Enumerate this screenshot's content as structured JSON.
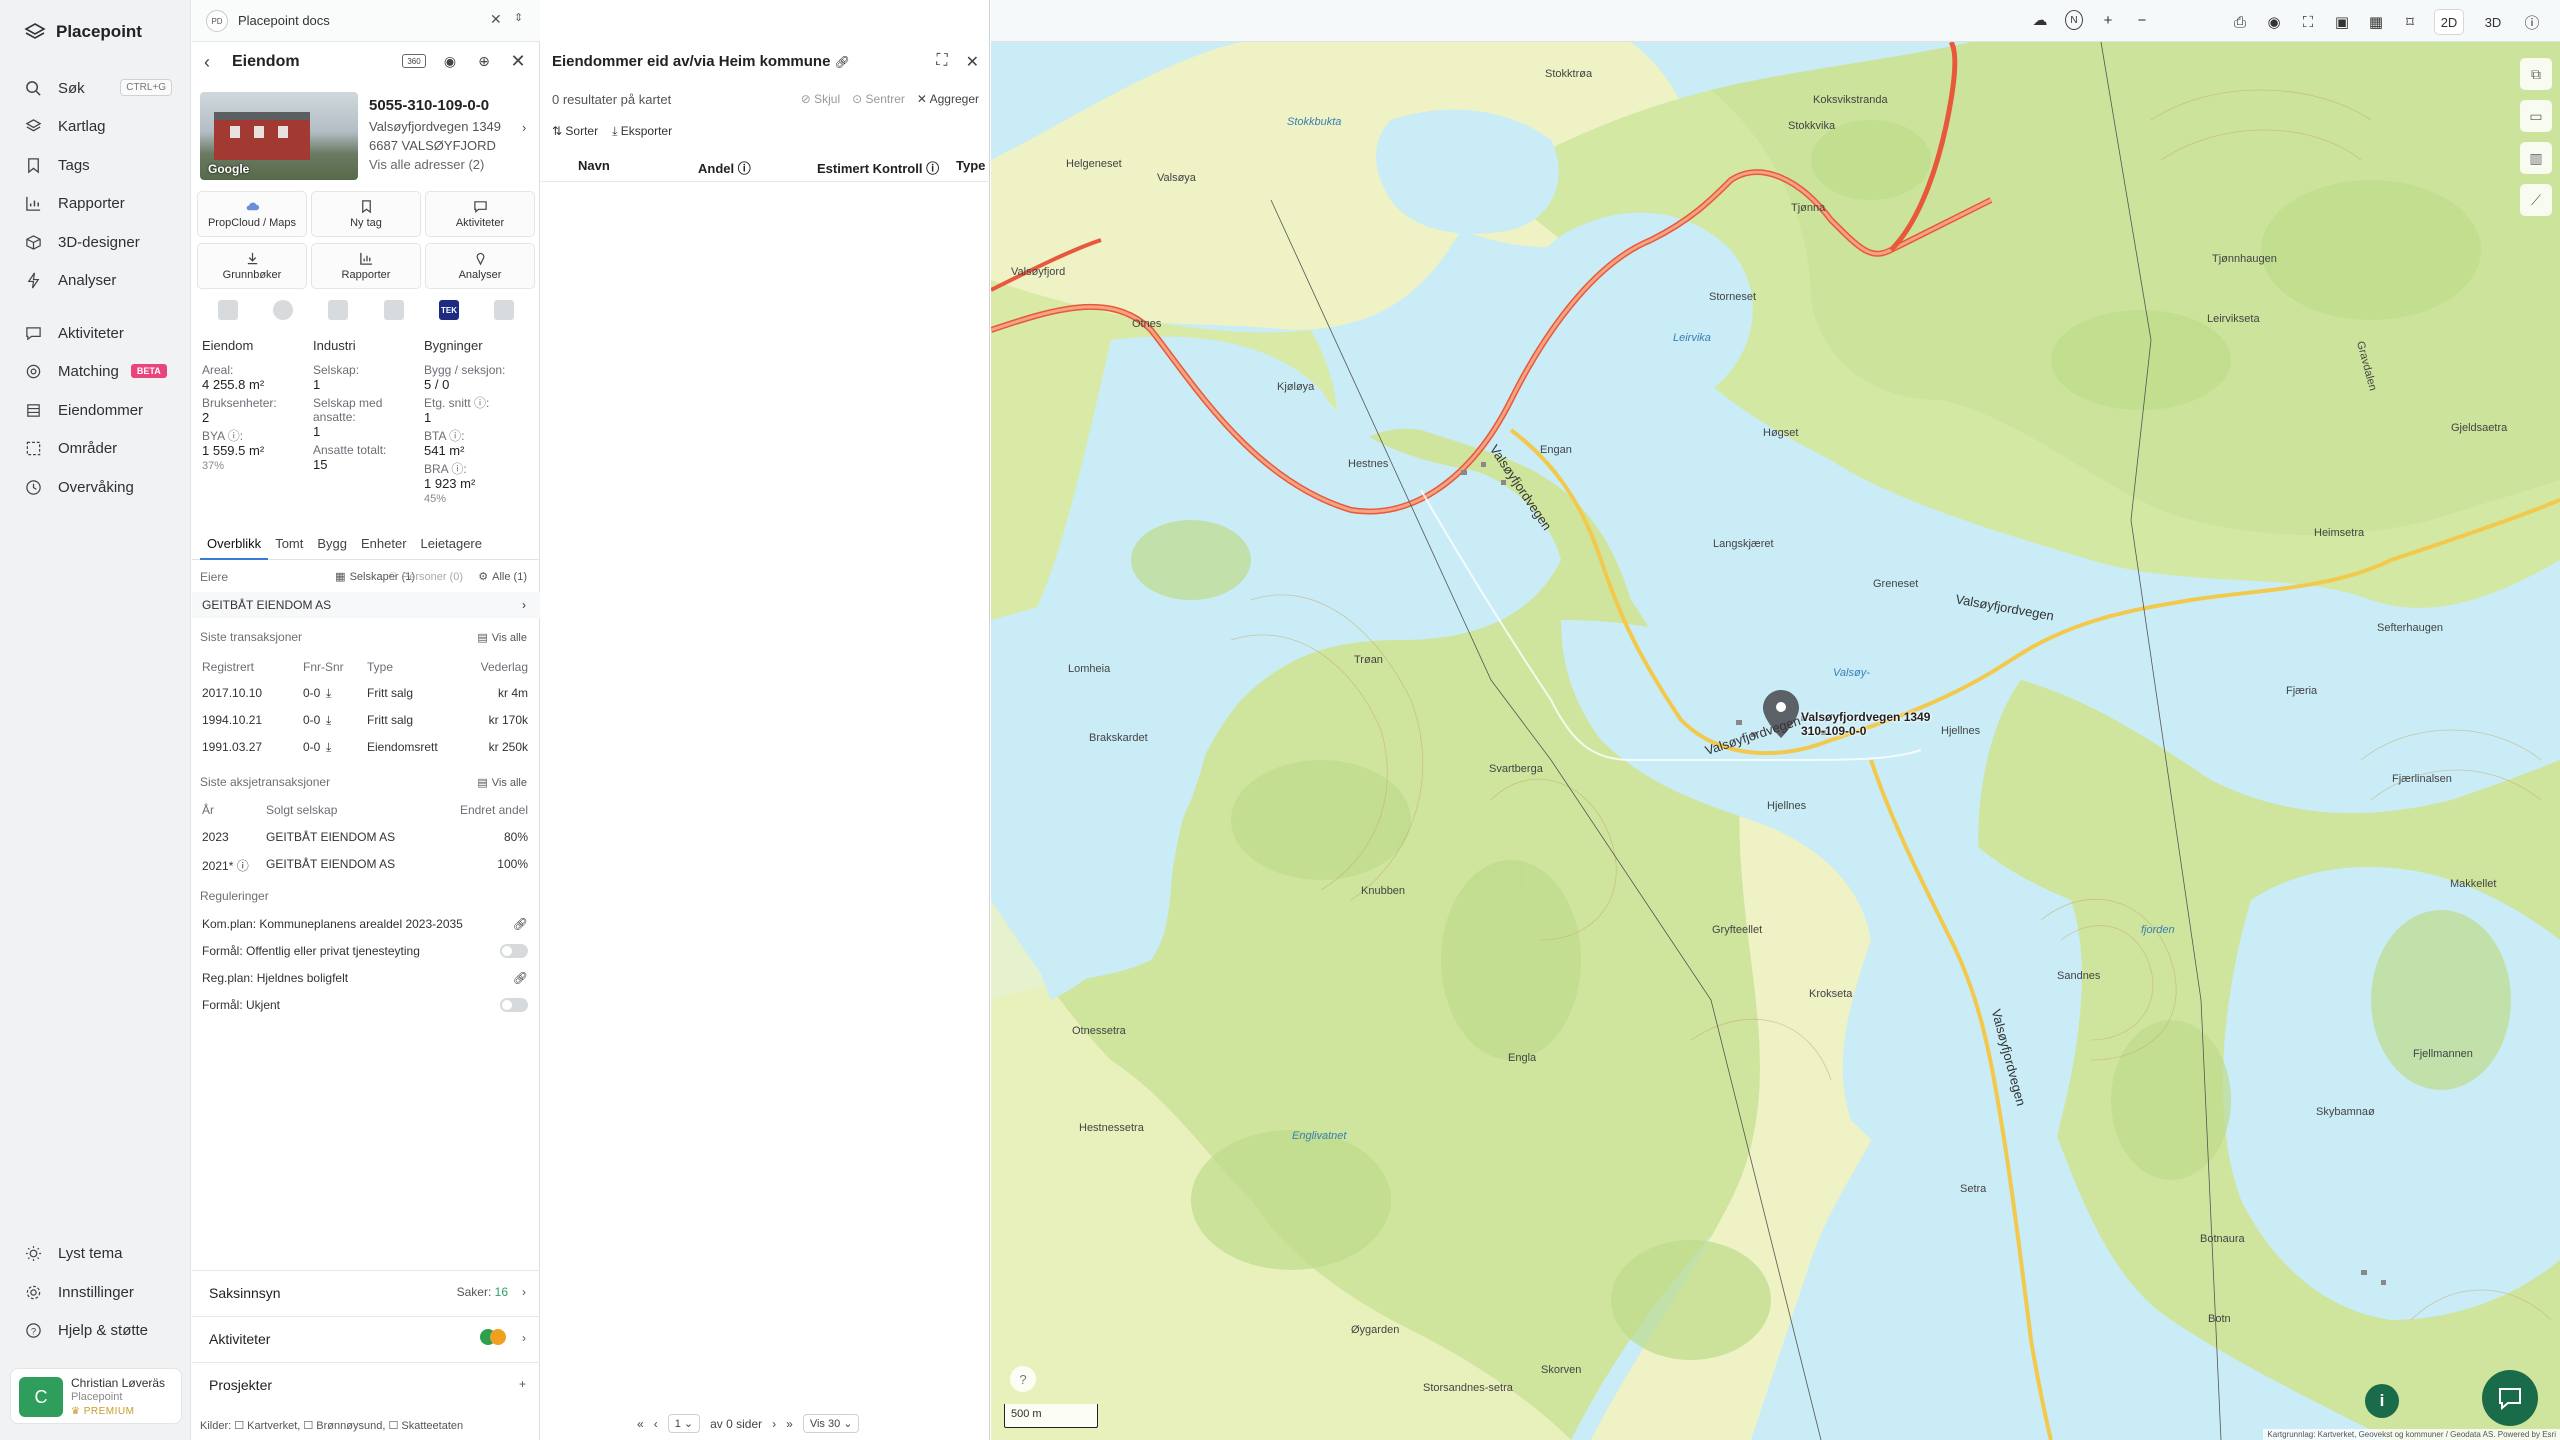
{
  "app": {
    "name": "Placepoint"
  },
  "nav": {
    "items": [
      {
        "label": "Søk",
        "shortcut": "CTRL+G"
      },
      {
        "label": "Kartlag"
      },
      {
        "label": "Tags"
      },
      {
        "label": "Rapporter"
      },
      {
        "label": "3D-designer"
      },
      {
        "label": "Analyser"
      },
      {
        "label": "Aktiviteter"
      },
      {
        "label": "Matching",
        "badge": "BETA"
      },
      {
        "label": "Eiendommer"
      },
      {
        "label": "Områder"
      },
      {
        "label": "Overvåking"
      }
    ],
    "bottom": [
      {
        "label": "Lyst tema"
      },
      {
        "label": "Innstillinger"
      },
      {
        "label": "Hjelp & støtte"
      }
    ],
    "user": {
      "initial": "C",
      "name": "Christian Løveräs",
      "org": "Placepoint",
      "plan": "PREMIUM"
    }
  },
  "docs": {
    "badge": "PD",
    "title": "Placepoint docs"
  },
  "property": {
    "panel_title": "Eiendom",
    "id": "5055-310-109-0-0",
    "address": "Valsøyfjordvegen 1349",
    "postal": "6687 VALSØYFJORD",
    "all_addresses": "Vis alle adresser (2)",
    "photo_credit": "Google",
    "tag_360": "360",
    "actions": [
      {
        "label": "PropCloud / Maps",
        "icon": "cloud-icon"
      },
      {
        "label": "Ny tag",
        "icon": "bookmark-icon"
      },
      {
        "label": "Aktiviteter",
        "icon": "chat-icon"
      },
      {
        "label": "Grunnbøker",
        "icon": "download-icon"
      },
      {
        "label": "Rapporter",
        "icon": "chart-icon"
      },
      {
        "label": "Analyser",
        "icon": "pin-icon"
      }
    ],
    "layer_tag": "TEK",
    "stats": {
      "eiendom": {
        "heading": "Eiendom",
        "areal_label": "Areal:",
        "areal_value": "4 255.8 m²",
        "bruk_label": "Bruksenheter:",
        "bruk_value": "2",
        "bya_label": "BYA ⓘ:",
        "bya_value": "1 559.5 m²",
        "bya_pct": "37%"
      },
      "industri": {
        "heading": "Industri",
        "selskap_label": "Selskap:",
        "selskap_value": "1",
        "ansatte_label": "Selskap med ansatte:",
        "ansatte_value": "1",
        "totalt_label": "Ansatte totalt:",
        "totalt_value": "15"
      },
      "bygninger": {
        "heading": "Bygninger",
        "bygg_label": "Bygg / seksjon:",
        "bygg_value": "5 / 0",
        "etg_label": "Etg. snitt ⓘ:",
        "etg_value": "1",
        "bta_label": "BTA ⓘ:",
        "bta_value": "541 m²",
        "bra_label": "BRA ⓘ:",
        "bra_value": "1 923 m²",
        "bra_pct": "45%"
      }
    },
    "tabs": [
      "Overblikk",
      "Tomt",
      "Bygg",
      "Enheter",
      "Leietagere"
    ],
    "owners": {
      "heading": "Eiere",
      "filters": [
        "Selskaper (1)",
        "Personer (0)",
        "Alle (1)"
      ],
      "rows": [
        "GEITBÅT EIENDOM AS"
      ]
    },
    "transactions": {
      "heading": "Siste transaksjoner",
      "link": "Vis alle",
      "columns": [
        "Registrert",
        "Fnr-Snr",
        "Type",
        "Vederlag"
      ],
      "rows": [
        [
          "2017.10.10",
          "0-0",
          "Fritt salg",
          "kr 4m"
        ],
        [
          "1994.10.21",
          "0-0",
          "Fritt salg",
          "kr 170k"
        ],
        [
          "1991.03.27",
          "0-0",
          "Eiendomsrett",
          "kr 250k"
        ]
      ]
    },
    "share_tx": {
      "heading": "Siste aksjetransaksjoner",
      "link": "Vis alle",
      "columns": [
        "År",
        "Solgt selskap",
        "Endret andel"
      ],
      "rows": [
        [
          "2023",
          "GEITBÅT EIENDOM AS",
          "80%"
        ],
        [
          "2021* ⓘ",
          "GEITBÅT EIENDOM AS",
          "100%"
        ]
      ]
    },
    "regulations": {
      "heading": "Reguleringer",
      "rows": [
        "Kom.plan: Kommuneplanens arealdel 2023-2035",
        "Formål: Offentlig eller privat tjenesteyting",
        "Reg.plan: Hjeldnes boligfelt",
        "Formål: Ukjent"
      ]
    },
    "saksinnsyn": {
      "label": "Saksinnsyn",
      "count_label": "Saker:",
      "count": "16"
    },
    "aktiviteter": {
      "label": "Aktiviteter"
    },
    "prosjekter": {
      "label": "Prosjekter"
    },
    "sources": "Kilder: ☐ Kartverket, ☐ Brønnøysund, ☐ Skatteetaten"
  },
  "results": {
    "title": "Eiendommer eid av/via Heim kommune",
    "count": "0 resultater på kartet",
    "actions": [
      "Skjul",
      "Sentrer",
      "Aggreger"
    ],
    "tools": [
      "Sorter",
      "Eksporter"
    ],
    "columns": [
      "Navn",
      "Andel ⓘ",
      "Estimert Kontroll ⓘ",
      "Type"
    ],
    "pager": {
      "page": "1",
      "of_pages": "av 0 sider",
      "per_page": "Vis 30"
    }
  },
  "map": {
    "view_modes": [
      "2D",
      "3D"
    ],
    "marker_label": "Valsøyfjordvegen 1349\n310-109-0-0",
    "scale": "500 m",
    "attribution": "Kartgrunnlag: Kartverket, Geovekst og kommuner / Geodata AS. Powered by Esri",
    "place_names": [
      "Valsøya",
      "Stokkbukta",
      "Stokktrøa",
      "Koksvikstranda",
      "Helgeneset",
      "Valsøyfjord",
      "Otnes",
      "Kjøløya",
      "Hestnes",
      "Engan",
      "Leirvika",
      "Tjønna",
      "Høgset",
      "Langskjæret",
      "Greneset",
      "Valsøyfjordvegen",
      "Lomheia",
      "Trøan",
      "Brakskardet",
      "Svartberga",
      "Hjellnes",
      "Knubben",
      "Gryfteellet",
      "Krokseta",
      "Sandnes",
      "Otnessetra",
      "Engla",
      "Hestnessetra",
      "Englivatnet",
      "Øygarden",
      "Skorven",
      "Storsandnes-setra",
      "Setra",
      "Skybamnaø",
      "Botnaura",
      "Botn",
      "Fjellmannen",
      "Makkellet",
      "Fjærlinalsen",
      "Fjæria",
      "Sefterhaugen",
      "Heimsetra",
      "Leirvikseta",
      "Gjeldsaetra",
      "Tjønnhaugen",
      "Gravdalen",
      "Valsøy-",
      "fjorden",
      "Storneset",
      "Stokkvika"
    ],
    "colors": {
      "water": "#c9ecf6",
      "land_light": "#eef2c4",
      "forest": "#cfe59d",
      "road_main": "#f08060",
      "road_minor": "#f5d25a",
      "accent_green": "#1a6b4a"
    }
  }
}
